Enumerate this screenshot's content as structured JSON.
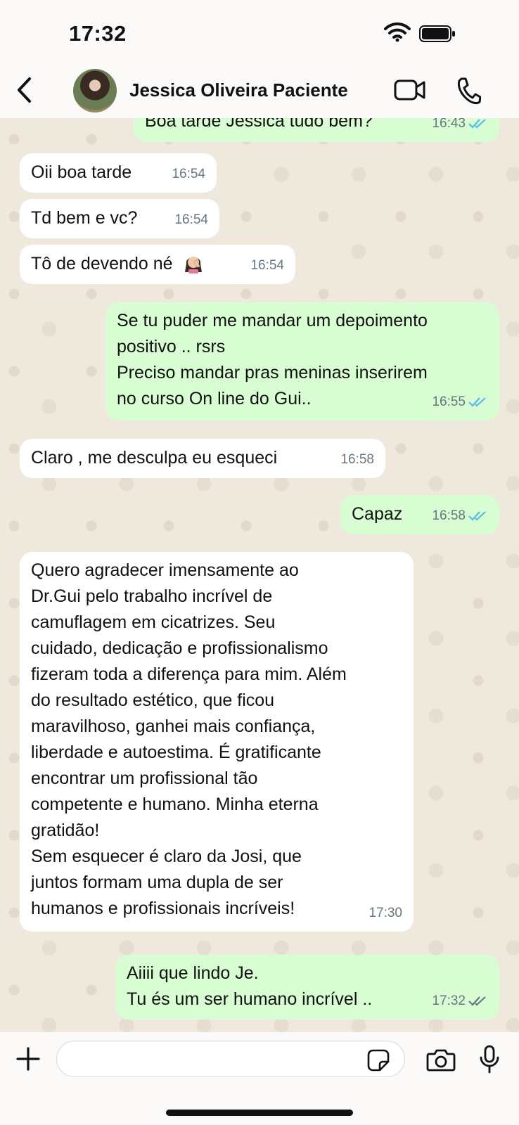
{
  "status_bar": {
    "time": "17:32"
  },
  "header": {
    "contact_name": "Jessica Oliveira Paciente"
  },
  "messages": [
    {
      "dir": "out",
      "text": "Boa tarde Jessica tudo bem?",
      "time": "16:43",
      "read": true
    },
    {
      "dir": "in",
      "text": "Oii boa tarde",
      "time": "16:54"
    },
    {
      "dir": "in",
      "text": "Td bem e vc?",
      "time": "16:54"
    },
    {
      "dir": "in",
      "text": "Tô de devendo né",
      "emoji": "woman-facepalming-emoji",
      "time": "16:54"
    },
    {
      "dir": "out",
      "text": "Se tu puder me mandar um depoimento\npositivo .. rsrs\nPreciso mandar pras meninas inserirem\nno curso On line do Gui..",
      "time": "16:55",
      "read": true
    },
    {
      "dir": "in",
      "text": "Claro , me desculpa eu esqueci",
      "time": "16:58"
    },
    {
      "dir": "out",
      "text": "Capaz",
      "time": "16:58",
      "read": true
    },
    {
      "dir": "in",
      "text": "Quero agradecer imensamente ao\nDr.Gui pelo trabalho incrível de\ncamuflagem em cicatrizes. Seu\ncuidado, dedicação e profissionalismo\nfizeram toda a diferença para mim. Além\ndo resultado estético, que ficou\nmaravilhoso, ganhei mais confiança,\nliberdade e autoestima. É gratificante\nencontrar um profissional tão\ncompetente e humano. Minha eterna\ngratidão!\nSem esquecer é claro da Josi, que\njuntos formam uma dupla de ser\nhumanos e profissionais incríveis!",
      "time": "17:30"
    },
    {
      "dir": "out",
      "text": "Aiiii que lindo Je.\nTu és um ser humano incrível ..",
      "time": "17:32",
      "read": false
    }
  ],
  "colors": {
    "incoming_bg": "#ffffff",
    "outgoing_bg": "#d9fdd3",
    "read_tick": "#53bdeb",
    "delivered_tick": "#667781"
  },
  "icons": [
    "back-icon",
    "video-call-icon",
    "phone-call-icon",
    "plus-icon",
    "sticker-icon",
    "camera-icon",
    "mic-icon"
  ]
}
